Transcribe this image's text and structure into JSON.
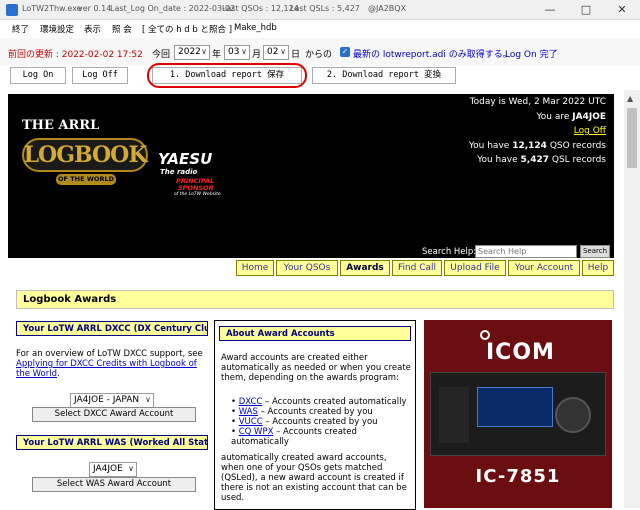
{
  "window": {
    "title_app": "LoTW2Thw.exe",
    "title_version": "ver 0.14",
    "title_last_logon": "Last_Log On_date : 2022-03-02",
    "title_last_qsos": "Last QSOs : 12,124",
    "title_last_qsls": "Last QSLs : 5,427",
    "title_call": "@JA2BQX",
    "minimize": "—",
    "maximize": "□",
    "close": "✕"
  },
  "menu": {
    "items": [
      "終了",
      "環境設定",
      "表示",
      "照 会",
      "[ 全ての h d b と照合 ]",
      "Make_hdb"
    ]
  },
  "controls": {
    "prev_update_label": "前回の更新 : 2022-02-02 17:52",
    "today_label": "今回",
    "year": "2022",
    "year_unit": "年",
    "month": "03",
    "month_unit": "月",
    "day": "02",
    "day_unit": "日",
    "from_label": "からの",
    "latest_checkbox_label": "最新の lotwreport.adi のみ取得する。",
    "logon_done": "Log On 完了",
    "logon_button": "Log On",
    "logoff_button": "Log Off",
    "download_save_button": "1. Download report  保存",
    "download_convert_button": "2. Download report 変換"
  },
  "lotw": {
    "logo_the_arrl": "THE ARRL",
    "logo_logbook": "LOGBOOK",
    "logo_of_the_world": "OF THE WORLD",
    "sponsor_brand": "YAESU",
    "sponsor_tagline": "The radio",
    "sponsor_principal": "PRINCIPAL",
    "sponsor_sponsor": "SPONSOR",
    "sponsor_sub": "of the LoTW Website",
    "today": "Today is Wed, 2 Mar 2022 UTC",
    "you_are_prefix": "You are",
    "callsign": "JA4JOE",
    "log_off": "Log Off",
    "qso_prefix": "You have",
    "qso_count": "12,124",
    "qso_suffix": "QSO records",
    "qsl_prefix": "You have",
    "qsl_count": "5,427",
    "qsl_suffix": "QSL records",
    "search_label": "Search Help:",
    "search_placeholder": "Search Help",
    "search_button": "Search",
    "nav": [
      "Home",
      "Your QSOs",
      "Awards",
      "Find Call",
      "Upload File",
      "Your Account",
      "Help"
    ]
  },
  "awards": {
    "section_title": "Logbook Awards",
    "dxcc_header": "Your LoTW ARRL DXCC (DX Century Club) Ac",
    "dxcc_text_1": "For an overview of LoTW DXCC support, see",
    "dxcc_link": "Applying for DXCC Credits with Logbook of the World",
    "dxcc_text_end": ".",
    "dxcc_select": "JA4JOE - JAPAN",
    "dxcc_button": "Select DXCC Award Account",
    "was_header": "Your LoTW ARRL WAS (Worked All States) Ac",
    "was_select": "JA4JOE",
    "was_button": "Select WAS Award Account",
    "about_header": "About Award Accounts",
    "about_text_1": "Award accounts are created either automatically as needed or when you create them, depending on the awards program:",
    "about_list": [
      {
        "link": "DXCC",
        "text": " – Accounts created automatically"
      },
      {
        "link": "WAS",
        "text": " – Accounts created by you"
      },
      {
        "link": "VUCC",
        "text": " – Accounts created by you"
      },
      {
        "link": "CQ WPX",
        "text": " – Accounts created automatically"
      }
    ],
    "about_text_2": "automatically created award accounts, when one of your QSOs gets matched (QSLed), a new award account is created if there is not an existing account that can be used.",
    "ad_brand": "ICOM",
    "ad_model": "IC-7851"
  },
  "colors": {
    "accent_blue": "#0000cc",
    "highlight_red": "#e00000",
    "nav_yellow": "#ffff99"
  }
}
